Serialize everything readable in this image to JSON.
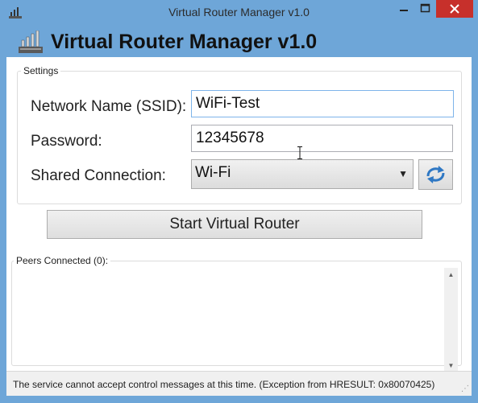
{
  "window": {
    "title": "Virtual Router Manager v1.0"
  },
  "caption_buttons": {
    "minimize": "—",
    "maximize": "□",
    "close": "✕"
  },
  "header": {
    "title": "Virtual Router Manager v1.0",
    "icon": "router-icon"
  },
  "settings": {
    "legend": "Settings",
    "ssid_label": "Network Name (SSID):",
    "ssid_value": "WiFi-Test",
    "password_label": "Password:",
    "password_value": "12345678",
    "shared_label": "Shared Connection:",
    "shared_value": "Wi-Fi",
    "refresh_icon": "refresh-icon"
  },
  "start_button": {
    "label": "Start Virtual Router"
  },
  "peers": {
    "legend": "Peers Connected (0):"
  },
  "status": {
    "text": "The service cannot accept control messages at this time. (Exception from HRESULT: 0x80070425)"
  },
  "colors": {
    "frame": "#6ea6d8",
    "close": "#c7302b",
    "refresh_arrow": "#2f78c4"
  }
}
